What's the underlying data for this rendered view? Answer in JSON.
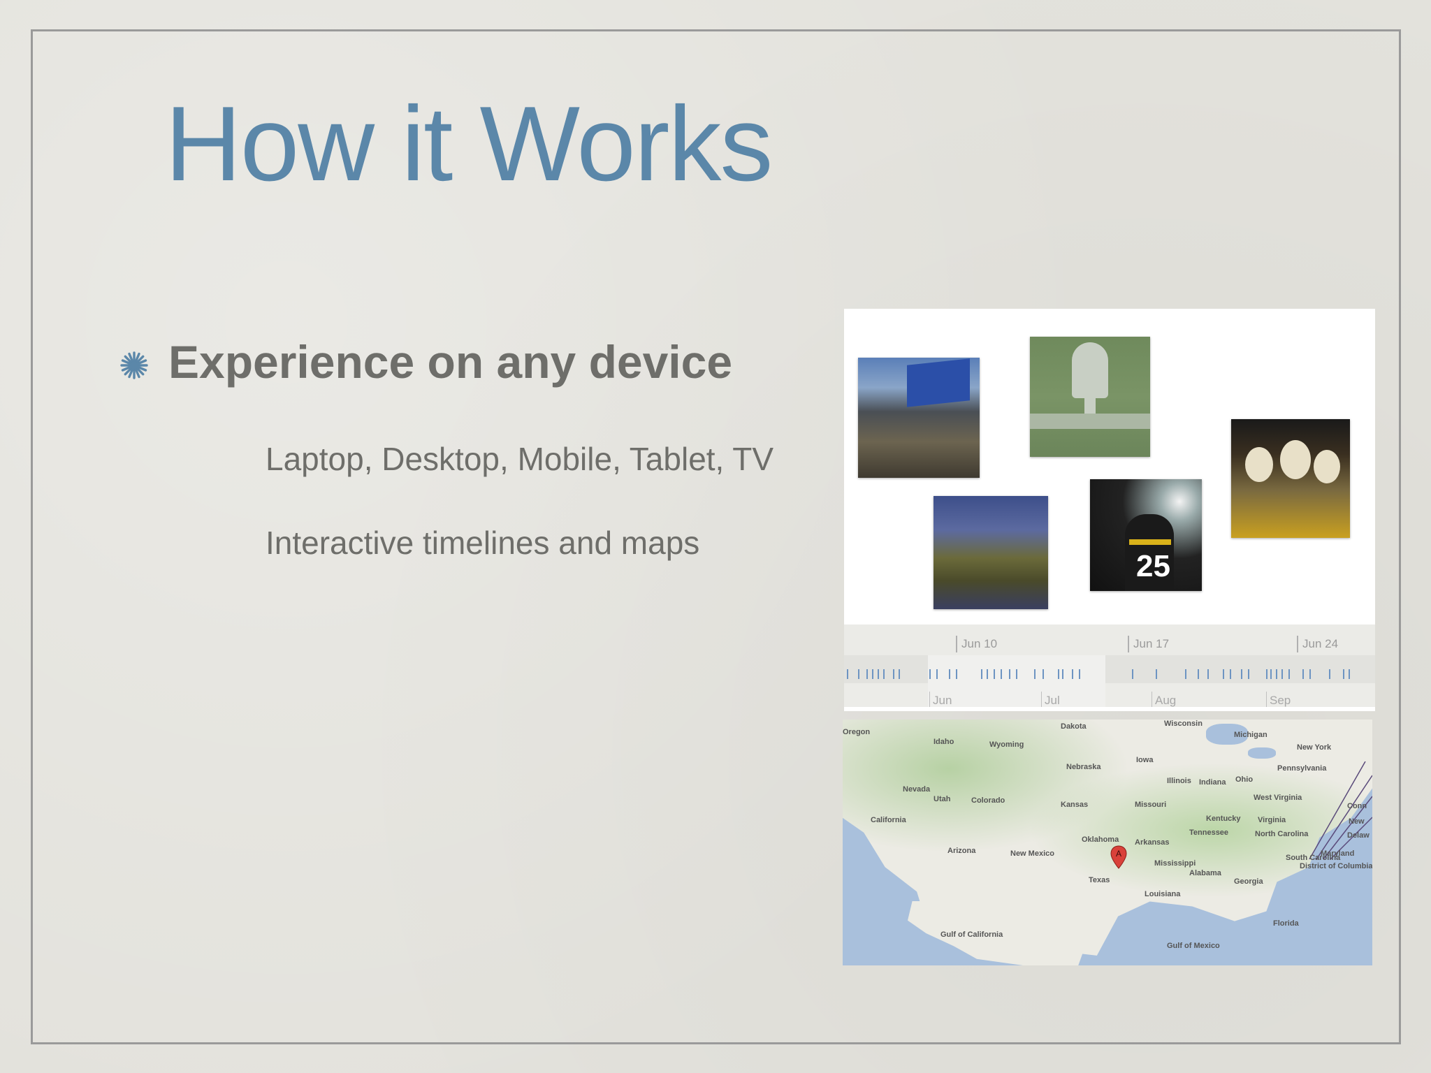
{
  "slide": {
    "title": "How it Works",
    "bullet": "Experience on any device",
    "subitems": [
      "Laptop, Desktop, Mobile, Tablet, TV",
      "Interactive timelines and maps"
    ]
  },
  "timeline": {
    "weeks": [
      "Jun 10",
      "Jun 17",
      "Jun 24"
    ],
    "months": [
      "Jun",
      "Jul",
      "Aug",
      "Sep"
    ]
  },
  "map": {
    "labels": [
      "Oregon",
      "Idaho",
      "Wyoming",
      "Nebraska",
      "Iowa",
      "Illinois",
      "Indiana",
      "Ohio",
      "Michigan",
      "New York",
      "Pennsylvania",
      "Nevada",
      "Utah",
      "Colorado",
      "Kansas",
      "Missouri",
      "Kentucky",
      "West Virginia",
      "Virginia",
      "California",
      "Arizona",
      "New Mexico",
      "Oklahoma",
      "Arkansas",
      "Tennessee",
      "North Carolina",
      "Maryland",
      "Mississippi",
      "Alabama",
      "Georgia",
      "South Carolina",
      "District of Columbia",
      "Texas",
      "Louisiana",
      "Florida",
      "Gulf of California",
      "Gulf of Mexico",
      "Dakota",
      "Wisconsin",
      "Conn",
      "Delaw",
      "New"
    ],
    "marker": "A"
  },
  "colors": {
    "title": "#5b87a9",
    "bullet_text": "#6e6e6a",
    "accent_star": "#5b87a9",
    "background": "#e3e2dc"
  }
}
